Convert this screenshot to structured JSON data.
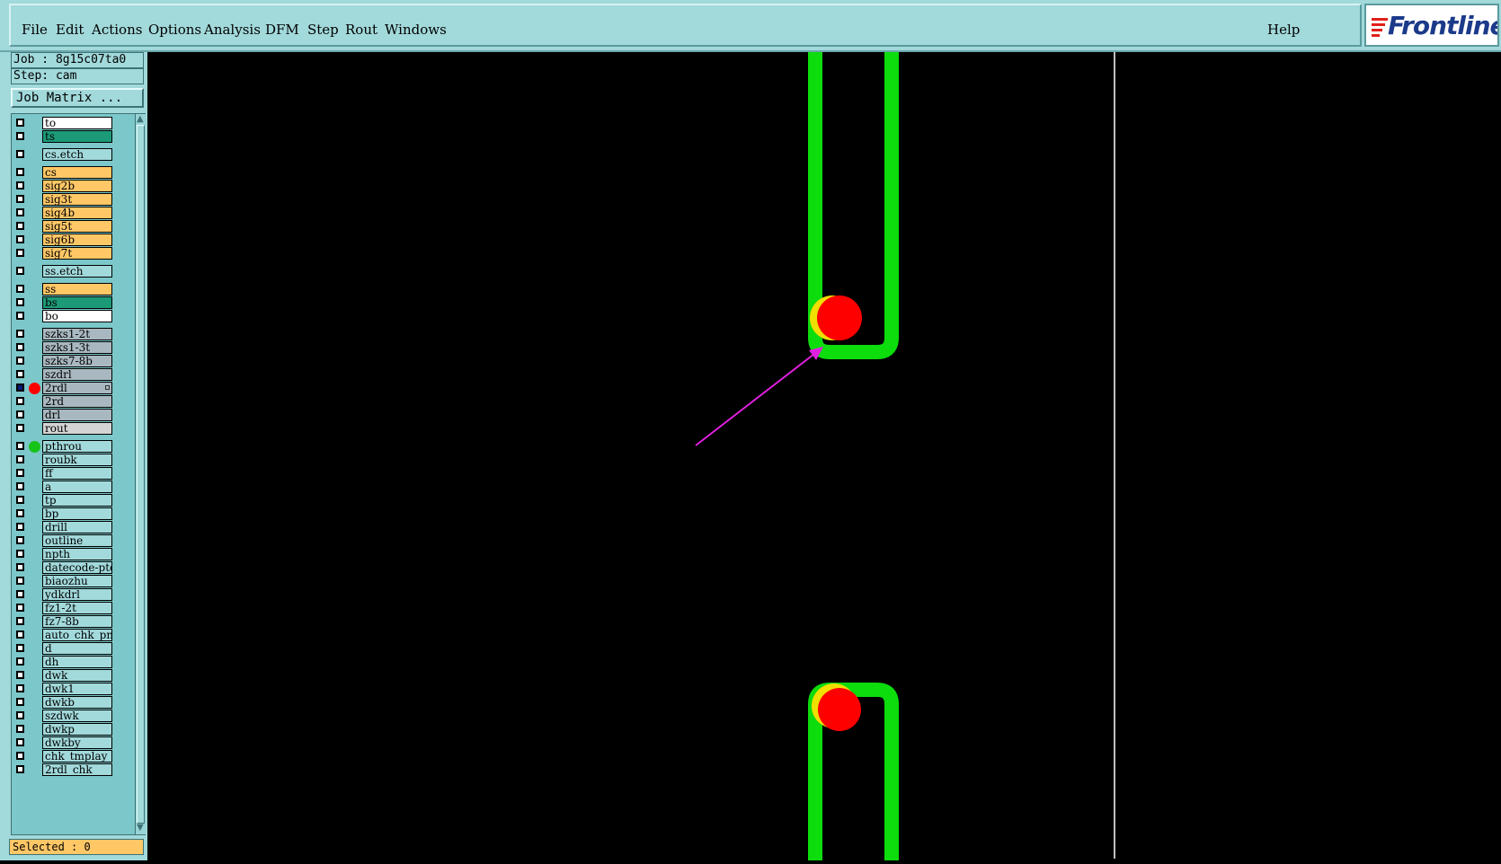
{
  "menu": {
    "items": [
      {
        "label": "File"
      },
      {
        "label": "Edit"
      },
      {
        "label": "Actions"
      },
      {
        "label": "Options"
      },
      {
        "label": "Analysis"
      },
      {
        "label": "DFM"
      },
      {
        "label": "Step"
      },
      {
        "label": "Rout"
      },
      {
        "label": "Windows"
      }
    ],
    "help": "Help",
    "logo": "Frontline"
  },
  "panel": {
    "job": "Job : 8g15c07ta0",
    "step": "Step: cam",
    "job_matrix": "Job Matrix ...",
    "selected": "Selected : 0"
  },
  "layers": [
    {
      "name": "to",
      "color": "#ffffff",
      "checked": false,
      "dot": null
    },
    {
      "name": "ts",
      "color": "#1c9a78",
      "checked": false,
      "dot": null
    },
    {
      "name": "cs.etch",
      "color": "#a2d9db",
      "checked": false,
      "dot": null
    },
    {
      "name": "cs",
      "color": "#ffc766",
      "checked": false,
      "dot": null
    },
    {
      "name": "sig2b",
      "color": "#ffc766",
      "checked": false,
      "dot": null
    },
    {
      "name": "sig3t",
      "color": "#ffc766",
      "checked": false,
      "dot": null
    },
    {
      "name": "sig4b",
      "color": "#ffc766",
      "checked": false,
      "dot": null
    },
    {
      "name": "sig5t",
      "color": "#ffc766",
      "checked": false,
      "dot": null
    },
    {
      "name": "sig6b",
      "color": "#ffc766",
      "checked": false,
      "dot": null
    },
    {
      "name": "sig7t",
      "color": "#ffc766",
      "checked": false,
      "dot": null
    },
    {
      "name": "ss.etch",
      "color": "#a2d9db",
      "checked": false,
      "dot": null
    },
    {
      "name": "ss",
      "color": "#ffc766",
      "checked": false,
      "dot": null
    },
    {
      "name": "bs",
      "color": "#1c9a78",
      "checked": false,
      "dot": null
    },
    {
      "name": "bo",
      "color": "#ffffff",
      "checked": false,
      "dot": null
    },
    {
      "name": "szks1-2t",
      "color": "#a9b8c0",
      "checked": false,
      "dot": null
    },
    {
      "name": "szks1-3t",
      "color": "#a9b8c0",
      "checked": false,
      "dot": null
    },
    {
      "name": "szks7-8b",
      "color": "#a9b8c0",
      "checked": false,
      "dot": null
    },
    {
      "name": "szdrl",
      "color": "#a9b8c0",
      "checked": false,
      "dot": null
    },
    {
      "name": "2rdl",
      "color": "#a9b8c0",
      "checked": true,
      "dot": "#ff0000",
      "mark": true
    },
    {
      "name": "2rd",
      "color": "#a9b8c0",
      "checked": false,
      "dot": null
    },
    {
      "name": "drl",
      "color": "#a9b8c0",
      "checked": false,
      "dot": null
    },
    {
      "name": "rout",
      "color": "#d4d4d4",
      "checked": false,
      "dot": null
    },
    {
      "name": "pthrou",
      "color": "#a2d9db",
      "checked": false,
      "dot": "#17c317"
    },
    {
      "name": "roubk",
      "color": "#a2d9db",
      "checked": false,
      "dot": null
    },
    {
      "name": "ff",
      "color": "#a2d9db",
      "checked": false,
      "dot": null
    },
    {
      "name": "a",
      "color": "#a2d9db",
      "checked": false,
      "dot": null
    },
    {
      "name": "tp",
      "color": "#a2d9db",
      "checked": false,
      "dot": null
    },
    {
      "name": "bp",
      "color": "#a2d9db",
      "checked": false,
      "dot": null
    },
    {
      "name": "drill",
      "color": "#a2d9db",
      "checked": false,
      "dot": null
    },
    {
      "name": "outline",
      "color": "#a2d9db",
      "checked": false,
      "dot": null
    },
    {
      "name": "npth",
      "color": "#a2d9db",
      "checked": false,
      "dot": null
    },
    {
      "name": "datecode-ptc",
      "color": "#a2d9db",
      "checked": false,
      "dot": null
    },
    {
      "name": "biaozhu",
      "color": "#a2d9db",
      "checked": false,
      "dot": null
    },
    {
      "name": "ydkdrl",
      "color": "#a2d9db",
      "checked": false,
      "dot": null
    },
    {
      "name": "fz1-2t",
      "color": "#a2d9db",
      "checked": false,
      "dot": null
    },
    {
      "name": "fz7-8b",
      "color": "#a2d9db",
      "checked": false,
      "dot": null
    },
    {
      "name": "auto_chk_pnl",
      "color": "#a2d9db",
      "checked": false,
      "dot": null
    },
    {
      "name": "d",
      "color": "#a2d9db",
      "checked": false,
      "dot": null
    },
    {
      "name": "dh",
      "color": "#a2d9db",
      "checked": false,
      "dot": null
    },
    {
      "name": "dwk",
      "color": "#a2d9db",
      "checked": false,
      "dot": null
    },
    {
      "name": "dwk1",
      "color": "#a2d9db",
      "checked": false,
      "dot": null
    },
    {
      "name": "dwkb",
      "color": "#a2d9db",
      "checked": false,
      "dot": null
    },
    {
      "name": "szdwk",
      "color": "#a2d9db",
      "checked": false,
      "dot": null
    },
    {
      "name": "dwkp",
      "color": "#a2d9db",
      "checked": false,
      "dot": null
    },
    {
      "name": "dwkby",
      "color": "#a2d9db",
      "checked": false,
      "dot": null
    },
    {
      "name": "chk_tmplay",
      "color": "#a2d9db",
      "checked": false,
      "dot": null
    },
    {
      "name": "2rdl_chk",
      "color": "#a2d9db",
      "checked": false,
      "dot": null
    }
  ],
  "colors": {
    "trace": "#0ddc0d",
    "drill_hit": "#ff0000",
    "drill_overlap": "#f0e000",
    "arrow": "#e020e0",
    "background": "#000000",
    "menu_bg": "#a2d9db"
  }
}
